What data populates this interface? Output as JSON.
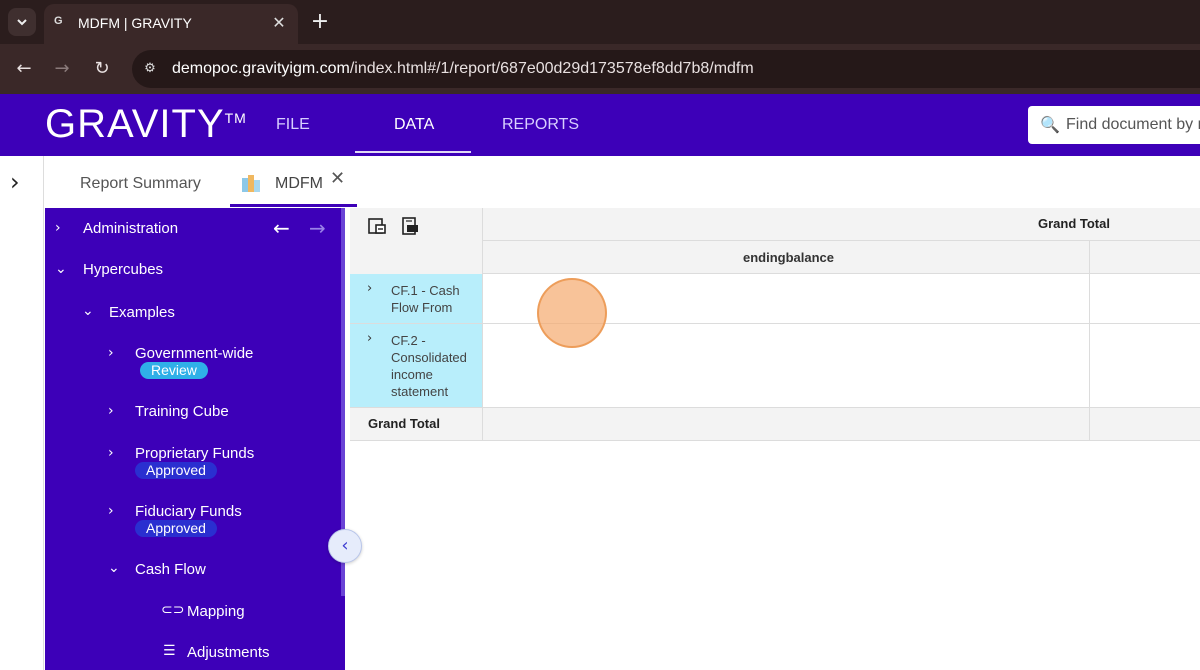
{
  "browser": {
    "tab_favicon": "G",
    "tab_title": "MDFM | GRAVITY",
    "url_host": "demopoc.gravityigm.com",
    "url_path": "/index.html#/1/report/687e00d29d173578ef8dd7b8/mdfm"
  },
  "header": {
    "logo": "GRAVITY",
    "logo_tm": "TM",
    "nav": [
      "FILE",
      "DATA",
      "REPORTS"
    ],
    "active_nav": "DATA",
    "search_placeholder": "Find document by n"
  },
  "tabs": {
    "report_summary": "Report Summary",
    "mdfm": "MDFM"
  },
  "sidebar": {
    "items": [
      {
        "label": "Administration"
      },
      {
        "label": "Hypercubes"
      },
      {
        "label": "Examples"
      },
      {
        "label": "Government-wide",
        "badge": "Review"
      },
      {
        "label": "Training Cube"
      },
      {
        "label": "Proprietary Funds",
        "badge": "Approved"
      },
      {
        "label": "Fiduciary Funds",
        "badge": "Approved"
      },
      {
        "label": "Cash Flow"
      },
      {
        "label": "Mapping"
      },
      {
        "label": "Adjustments"
      }
    ]
  },
  "grid": {
    "column_header": "Grand Total",
    "measure_header": "endingbalance",
    "rows": [
      {
        "label": "CF.1 - Cash Flow From"
      },
      {
        "label": "CF.2 - Consolidated income statement"
      }
    ],
    "total_row": "Grand Total"
  },
  "colors": {
    "brand": "#3d00b8",
    "row_highlight": "#b8eefb",
    "badge_review": "#2fb0e8",
    "badge_approved": "#2a2fd0"
  }
}
